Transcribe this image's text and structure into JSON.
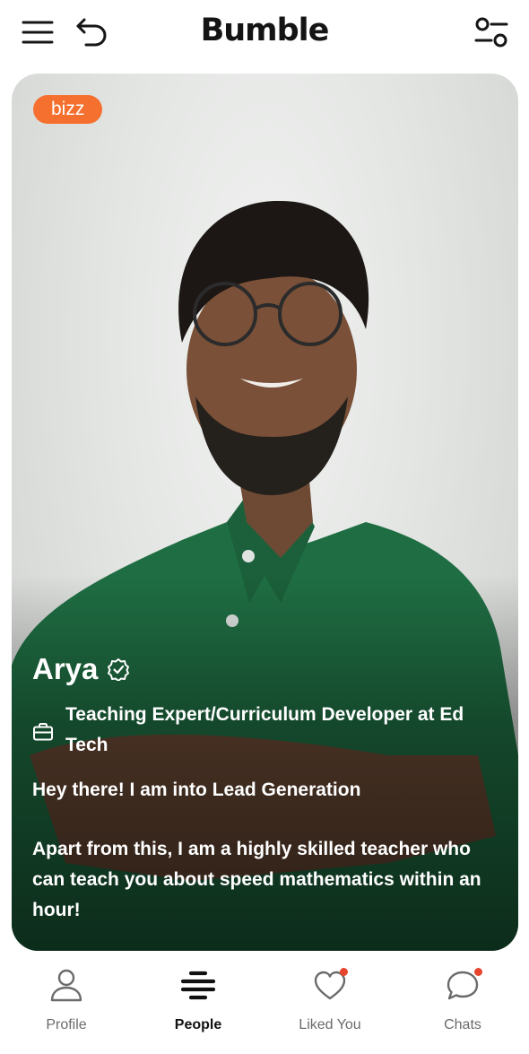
{
  "header": {
    "brand": "Bumble",
    "menu_icon": "menu-icon",
    "back_icon": "undo-icon",
    "filter_icon": "filter-icon"
  },
  "card": {
    "badge": "bizz",
    "name": "Arya",
    "verified_icon": "verified-icon",
    "job_icon": "briefcase-icon",
    "job": "Teaching Expert/Curriculum Developer at Ed Tech",
    "bio": [
      "Hey there! I am into Lead Generation",
      "Apart from this, I am a highly skilled teacher who can teach you about speed mathematics within an hour!"
    ]
  },
  "nav": {
    "items": [
      {
        "label": "Profile",
        "icon": "profile-icon",
        "active": false
      },
      {
        "label": "People",
        "icon": "people-icon",
        "active": true
      },
      {
        "label": "Liked You",
        "icon": "heart-icon",
        "active": false,
        "notification": true
      },
      {
        "label": "Chats",
        "icon": "chat-icon",
        "active": false,
        "notification": true
      }
    ]
  },
  "colors": {
    "badge": "#f5702e",
    "notification": "#e8452f",
    "shirt": "#1f6e43"
  }
}
